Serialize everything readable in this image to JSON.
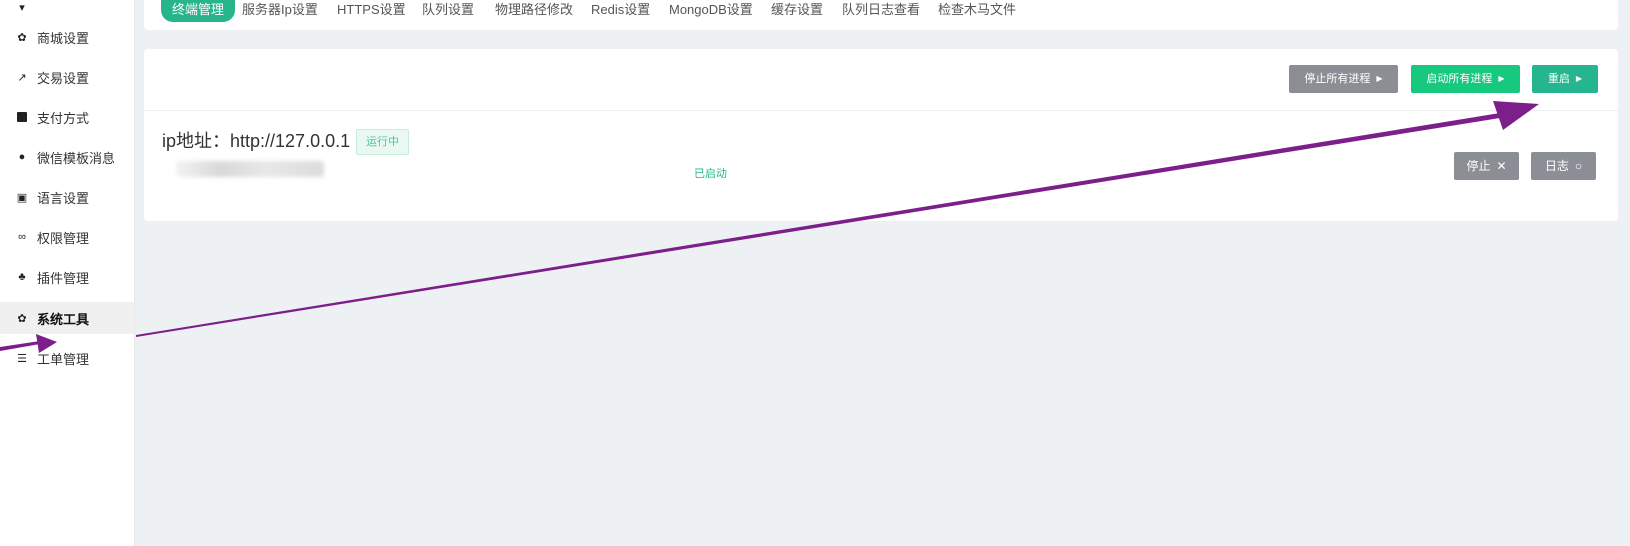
{
  "sidebar": {
    "items": [
      {
        "label": "",
        "icon": "partial-icon"
      },
      {
        "label": "商城设置",
        "icon": "gear-icon"
      },
      {
        "label": "交易设置",
        "icon": "exchange-icon"
      },
      {
        "label": "支付方式",
        "icon": "facebook-square-icon"
      },
      {
        "label": "微信模板消息",
        "icon": "wechat-icon"
      },
      {
        "label": "语言设置",
        "icon": "translate-icon"
      },
      {
        "label": "权限管理",
        "icon": "glasses-icon"
      },
      {
        "label": "插件管理",
        "icon": "puzzle-icon"
      },
      {
        "label": "系统工具",
        "icon": "gear-icon",
        "active": true
      },
      {
        "label": "工单管理",
        "icon": "list-icon"
      }
    ]
  },
  "tabs": [
    {
      "label": "终端管理",
      "active": true
    },
    {
      "label": "服务器Ip设置"
    },
    {
      "label": "HTTPS设置"
    },
    {
      "label": "队列设置"
    },
    {
      "label": "物理路径修改"
    },
    {
      "label": "Redis设置"
    },
    {
      "label": "MongoDB设置"
    },
    {
      "label": "缓存设置"
    },
    {
      "label": "队列日志查看"
    },
    {
      "label": "检查木马文件"
    }
  ],
  "toolbar": {
    "stop_all": "停止所有进程",
    "start_all": "启动所有进程",
    "restart": "重启"
  },
  "server": {
    "ip_label": "ip地址：http://127.0.0.1",
    "badge": "运行中",
    "status": "已启动",
    "stop": "停止",
    "log": "日志"
  },
  "colors": {
    "accent": "#27b58b",
    "start_green": "#17c97e",
    "gray_button": "#8b8f95",
    "arrow": "#7d1f8a"
  }
}
